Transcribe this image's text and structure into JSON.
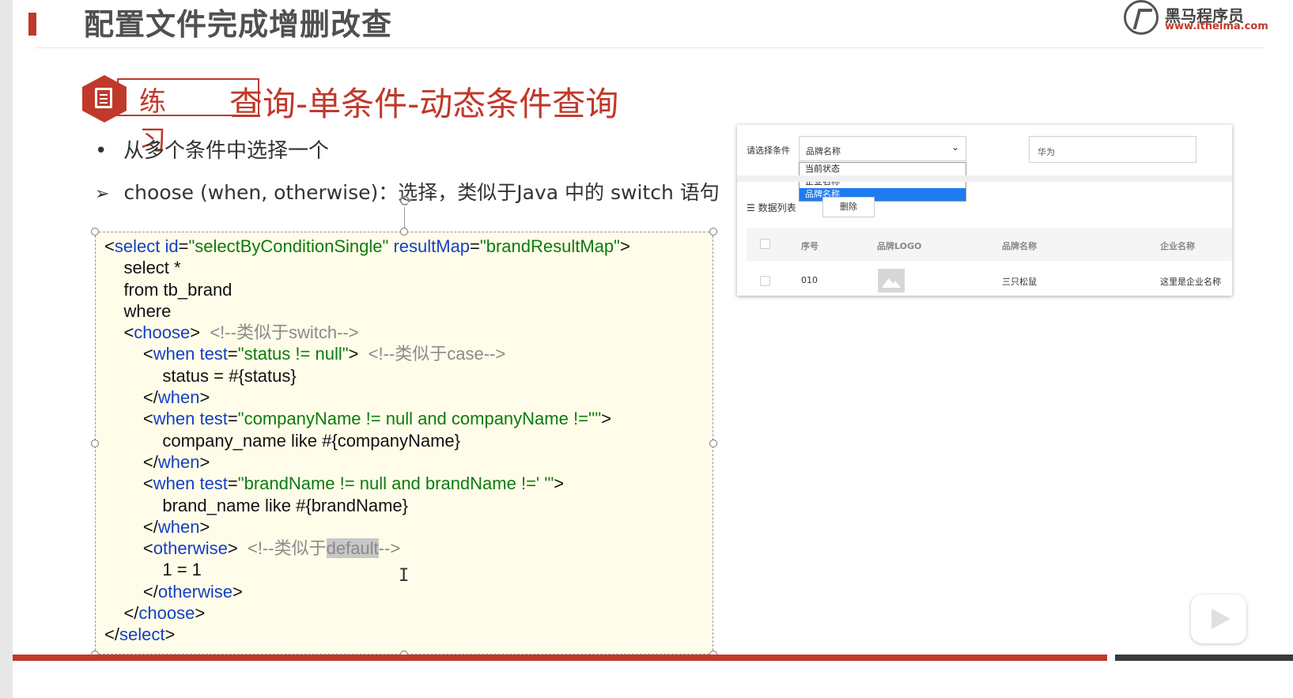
{
  "header": {
    "title": "配置文件完成增删改查",
    "logo_name": "黑马程序员",
    "logo_url": "www.itheima.com"
  },
  "section": {
    "badge_label": "练习",
    "heading": "查询-单条件-动态条件查询"
  },
  "bullets": {
    "item1": "从多个条件中选择一个",
    "item2": "choose (when, otherwise)：选择，类似于Java 中的 switch 语句"
  },
  "code": {
    "l1_a": "<",
    "l1_tag": "select",
    "l1_attr1": " id",
    "l1_eq1": "=",
    "l1_val1": "\"selectByConditionSingle\"",
    "l1_attr2": " resultMap",
    "l1_eq2": "=",
    "l1_val2": "\"brandResultMap\"",
    "l1_b": ">",
    "l2": "    select *",
    "l3": "    from tb_brand",
    "l4": "    where",
    "l5_ind": "    <",
    "l5_tag": "choose",
    "l5_b": ">",
    "l5_cm": "  <!--类似于switch-->",
    "l6_ind": "        <",
    "l6_tag": "when",
    "l6_attr": " test",
    "l6_eq": "=",
    "l6_val": "\"status != null\"",
    "l6_b": ">",
    "l6_cm": "  <!--类似于case-->",
    "l7": "            status = #{status}",
    "l8_ind": "        </",
    "l8_tag": "when",
    "l8_b": ">",
    "l9_ind": "        <",
    "l9_tag": "when",
    "l9_attr": " test",
    "l9_eq": "=",
    "l9_val": "\"companyName != null and companyName !=''\"",
    "l9_b": ">",
    "l10": "            company_name like #{companyName}",
    "l11_ind": "        </",
    "l11_tag": "when",
    "l11_b": ">",
    "l12_ind": "        <",
    "l12_tag": "when",
    "l12_attr": " test",
    "l12_eq": "=",
    "l12_val": "\"brandName != null and brandName !=' '\"",
    "l12_b": ">",
    "l13": "            brand_name like #{brandName}",
    "l14_ind": "        </",
    "l14_tag": "when",
    "l14_b": ">",
    "l15_ind": "        <",
    "l15_tag": "otherwise",
    "l15_b": ">",
    "l15_cm1": "  <!--类似于",
    "l15_cm_hl": "default",
    "l15_cm2": "-->",
    "l16": "            1 = 1",
    "l17_ind": "        </",
    "l17_tag": "otherwise",
    "l17_b": ">",
    "l18_ind": "    </",
    "l18_tag": "choose",
    "l18_b": ">",
    "l19_a": "</",
    "l19_tag": "select",
    "l19_b": ">"
  },
  "app": {
    "condition_label": "请选择条件",
    "select_value": "品牌名称",
    "options": [
      "当前状态",
      "企业名称",
      "品牌名称"
    ],
    "selected_option_index": 2,
    "search_value": "华为",
    "list_title": "数据列表",
    "delete_button": "删除",
    "columns": [
      "序号",
      "品牌LOGO",
      "品牌名称",
      "企业名称"
    ],
    "rows": [
      {
        "id": "010",
        "brand_name": "三只松鼠",
        "company_name": "这里是企业名称"
      }
    ]
  }
}
